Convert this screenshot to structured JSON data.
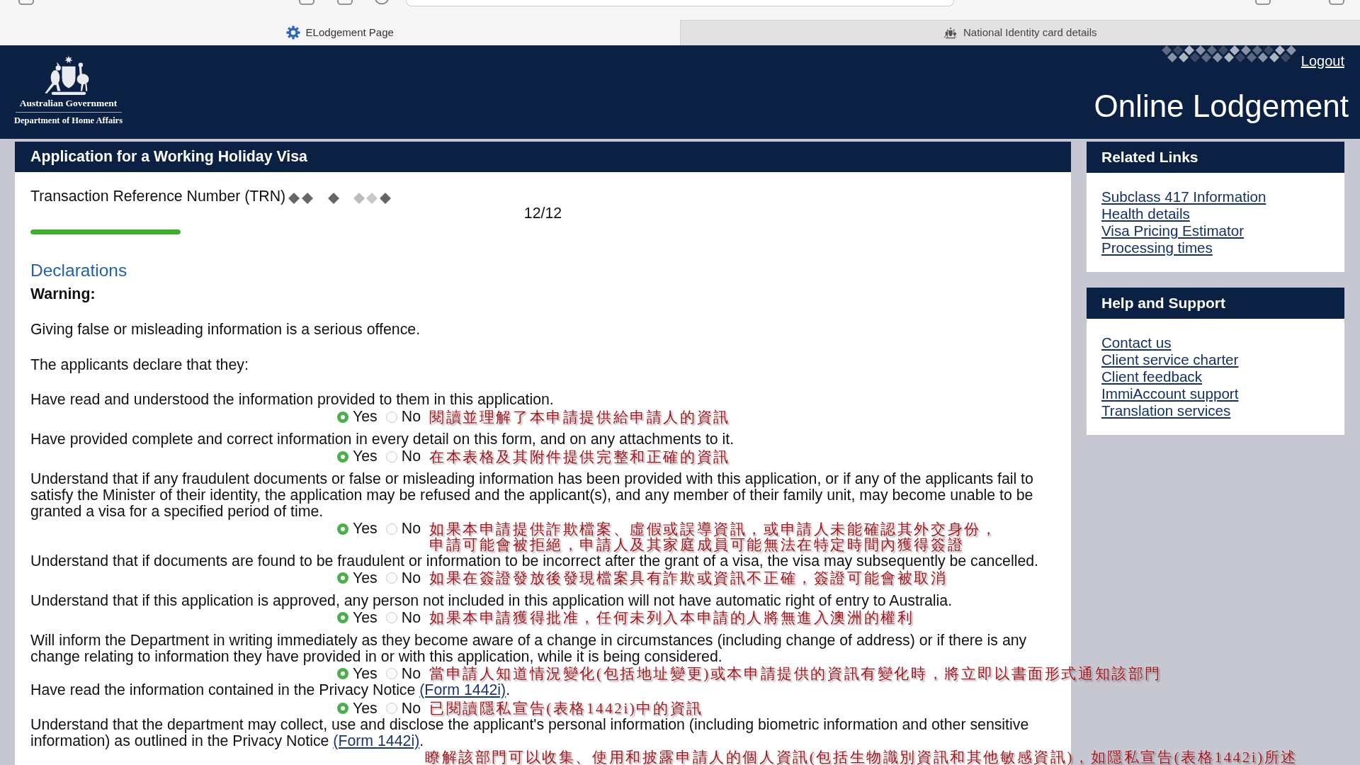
{
  "browser": {
    "tabs": [
      {
        "title": "ELodgement Page",
        "selected": true
      },
      {
        "title": "National Identity card details",
        "selected": false
      }
    ]
  },
  "header": {
    "agency": [
      "Australian Government",
      "Department of Home Affairs"
    ],
    "logout": "Logout",
    "title": "Online Lodgement"
  },
  "main": {
    "title": "Application for a Working Holiday Visa",
    "trn_label": "Transaction Reference Number (TRN)",
    "step": "12/12",
    "progress": {
      "level": 1
    },
    "section": "Declarations",
    "warning": "Warning:",
    "paragraphs": [
      "Giving false or misleading information is a serious offence.",
      "The applicants declare that they:"
    ],
    "declarations": [
      {
        "text": "Have read and understood the information provided to them in this application.",
        "options": [
          {
            "label": "Yes",
            "selected": true
          },
          {
            "label": "No",
            "selected": false
          }
        ],
        "note": [
          "閱讀並理解了本申請提供給申請人的資訊"
        ]
      },
      {
        "text": "Have provided complete and correct information in every detail on this form, and on any attachments to it.",
        "options": [
          {
            "label": "Yes",
            "selected": true
          },
          {
            "label": "No",
            "selected": false
          }
        ],
        "note": [
          "在本表格及其附件提供完整和正確的資訊"
        ]
      },
      {
        "text": "Understand that if any fraudulent documents or false or misleading information has been provided with this application, or if any of the applicants fail to satisfy the Minister of their identity, the application may be refused and the applicant(s), and any member of their family unit, may become unable to be granted a visa for a specified period of time.",
        "options": [
          {
            "label": "Yes",
            "selected": true
          },
          {
            "label": "No",
            "selected": false
          }
        ],
        "note": [
          "如果本申請提供詐欺檔案、虛假或誤導資訊，或申請人未能確認其外交身份，",
          "申請可能會被拒絕，申請人及其家庭成員可能無法在特定時間內獲得簽證"
        ]
      },
      {
        "text": "Understand that if documents are found to be fraudulent or information to be incorrect after the grant of a visa, the visa may subsequently be cancelled.",
        "options": [
          {
            "label": "Yes",
            "selected": true
          },
          {
            "label": "No",
            "selected": false
          }
        ],
        "note": [
          "如果在簽證發放後發現檔案具有詐欺或資訊不正確，簽證可能會被取消"
        ]
      },
      {
        "text": "Understand that if this application is approved, any person not included in this application will not have automatic right of entry to Australia.",
        "options": [
          {
            "label": "Yes",
            "selected": true
          },
          {
            "label": "No",
            "selected": false
          }
        ],
        "note": [
          "如果本申請獲得批准，任何未列入本申請的人將無進入澳洲的權利"
        ]
      },
      {
        "text": "Will inform the Department in writing immediately as they become aware of a change in circumstances (including change of address) or if there is any change relating to information they have provided in or with this application, while it is being considered.",
        "options": [
          {
            "label": "Yes",
            "selected": true
          },
          {
            "label": "No",
            "selected": false
          }
        ],
        "note": [
          "當申請人知道情況變化(包括地址變更)或本申請提供的資訊有變化時，將立即以書面形式通知該部門"
        ]
      },
      {
        "text": "Have read the information contained in the Privacy Notice ",
        "link": "(Form 1442i)",
        "after": ".",
        "options": [
          {
            "label": "Yes",
            "selected": true
          },
          {
            "label": "No",
            "selected": false
          }
        ],
        "note": [
          "已閱讀隱私宣告(表格1442i)中的資訊"
        ]
      },
      {
        "text": "Understand that the department may collect, use and disclose the applicant's personal information (including biometric information and other sensitive information) as outlined in the Privacy Notice ",
        "link": "(Form 1442i)",
        "after": ".",
        "note": [
          "瞭解該部門可以收集、使用和披露申請人的個人資訊(包括生物識別資訊和其他敏感資訊)，如隱私宣告(表格1442i)所述"
        ]
      }
    ]
  },
  "sidebar": [
    {
      "title": "Related Links",
      "links": [
        "Subclass 417 Information",
        "Health details",
        "Visa Pricing Estimator",
        "Processing times"
      ]
    },
    {
      "title": "Help and Support",
      "links": [
        "Contact us",
        "Client service charter",
        "Client feedback",
        "ImmiAccount support",
        "Translation services"
      ]
    }
  ]
}
